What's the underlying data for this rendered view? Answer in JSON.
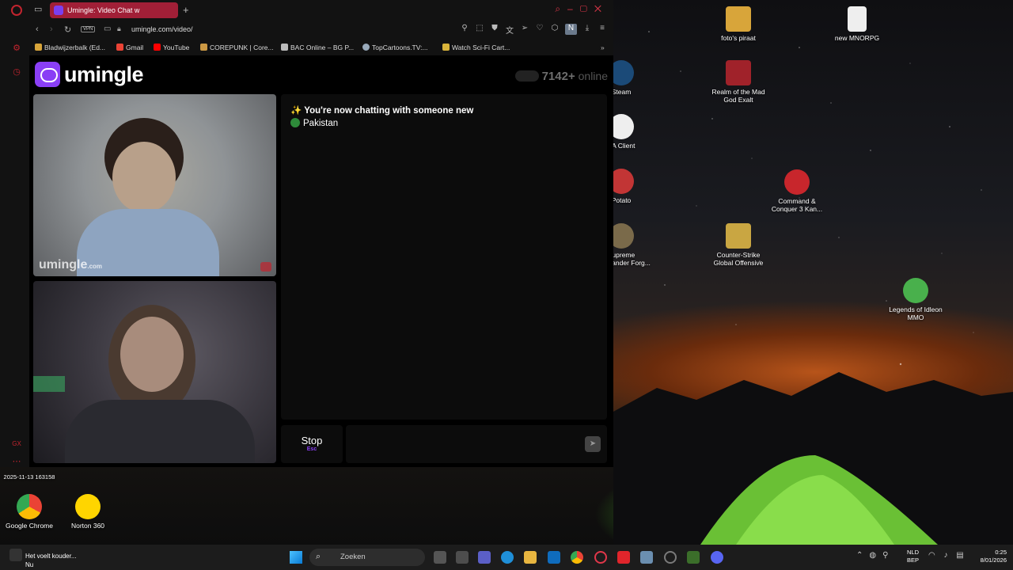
{
  "browser": {
    "tab_title": "Umingle: Video Chat w",
    "add_tab": "+",
    "url": "umingle.com/video/",
    "vpn_label": "VPN",
    "profile_initial": "N"
  },
  "bookmarks": [
    {
      "label": "Bladwijzerbalk (Ed...",
      "icon": "folder-icon",
      "color": "#d8a53a"
    },
    {
      "label": "Gmail",
      "icon": "gmail-icon",
      "color": "#ea4335"
    },
    {
      "label": "YouTube",
      "icon": "youtube-icon",
      "color": "#ff0000"
    },
    {
      "label": "COREPUNK | Core...",
      "icon": "corepunk-icon",
      "color": "#c94"
    },
    {
      "label": "BAC Online – BG P...",
      "icon": "bac-icon",
      "color": "#bbb"
    },
    {
      "label": "TopCartoons.TV:...",
      "icon": "topcartoons-icon",
      "color": "#9ab"
    },
    {
      "label": "Watch Sci-Fi Cart...",
      "icon": "scifi-icon",
      "color": "#d9b43a"
    }
  ],
  "site": {
    "logo_text": "umingle",
    "online_count": "7142+",
    "online_label": "online",
    "watermark": "umingle",
    "watermark_suffix": ".com",
    "chat_line1": "✨ You're now chatting with someone new",
    "chat_country": "Pakistan",
    "stop_label": "Stop",
    "stop_shortcut": "Esc",
    "send_icon": "send-icon"
  },
  "desktop_icons": [
    {
      "label": "foto's piraat",
      "name": "desk-foto-s-piraat",
      "color": "#d8a53a"
    },
    {
      "label": "new MNORPG",
      "name": "desk-new-mnorpg",
      "color": "#eeeeee"
    },
    {
      "label": "Realm of the Mad God Exalt",
      "name": "desk-realm-of-the-mad-god",
      "color": "#a0222a"
    },
    {
      "label": "Command & Conquer 3 Kan...",
      "name": "desk-command-conquer",
      "color": "#c8262c"
    },
    {
      "label": "Counter-Strike Global Offensive",
      "name": "desk-csgo",
      "color": "#c9a642"
    },
    {
      "label": "Legends of Idleon MMO",
      "name": "desk-legends-of-idleon",
      "color": "#49b04c"
    },
    {
      "label": "Steam",
      "name": "desk-steam",
      "color": "#1b4a78"
    },
    {
      "label": "EA Client",
      "name": "desk-ea-client",
      "color": "#eeeeee"
    },
    {
      "label": "Potato",
      "name": "desk-potato",
      "color": "#c23535"
    },
    {
      "label": "Supreme Commander Forg...",
      "name": "desk-supreme-commander",
      "color": "#7a6a4a"
    },
    {
      "label": "Google Chrome",
      "name": "desk-google-chrome",
      "color": "#4285f4"
    },
    {
      "label": "Norton 360",
      "name": "desk-norton-360",
      "color": "#ffd500"
    },
    {
      "label": "2025-11-13 163158",
      "name": "desk-screenshot",
      "color": "#888888"
    }
  ],
  "taskbar": {
    "notification_title": "Het voelt kouder...",
    "notification_sub": "Nu",
    "search_placeholder": "Zoeken",
    "lang1": "NLD",
    "lang2": "BEP",
    "time": "0:25",
    "date": "8/01/2026"
  }
}
